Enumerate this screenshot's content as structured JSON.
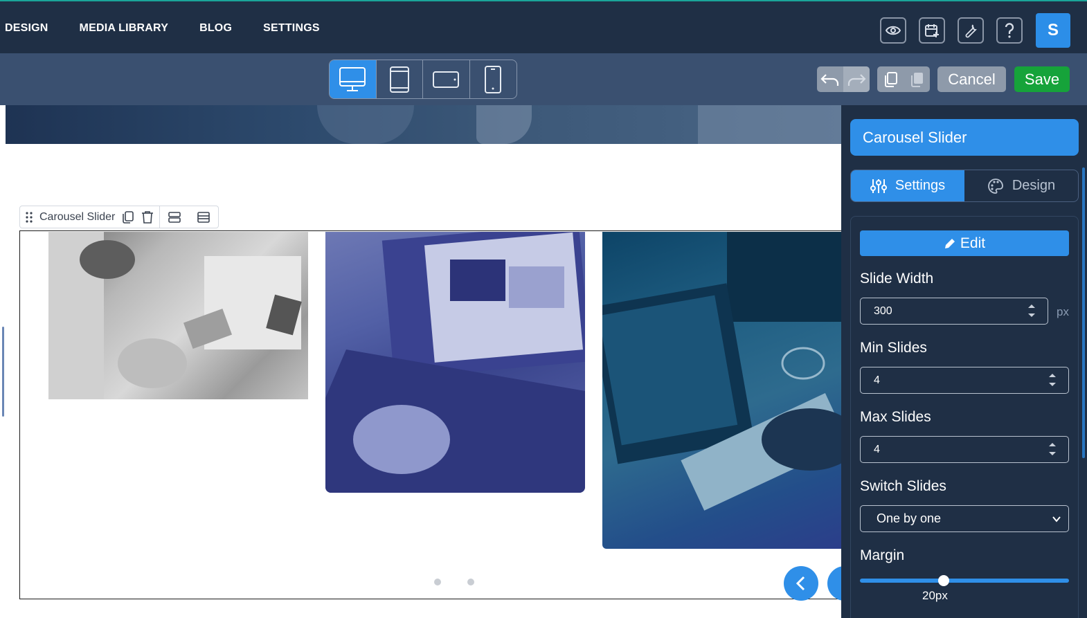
{
  "topnav": {
    "items": [
      "DESIGN",
      "MEDIA LIBRARY",
      "BLOG",
      "SETTINGS"
    ],
    "icons": [
      "eye-icon",
      "calendar-plus-icon",
      "wrench-icon",
      "question-icon"
    ],
    "avatar_letter": "S"
  },
  "toolbar": {
    "devices": [
      "desktop",
      "tablet",
      "tablet-landscape",
      "mobile"
    ],
    "active_device": "desktop",
    "cancel_label": "Cancel",
    "save_label": "Save"
  },
  "canvas": {
    "element_label": "Carousel Slider",
    "slides": [
      "office-people-photo",
      "laptop-design-photo",
      "tablet-code-photo"
    ],
    "dot_count": 2
  },
  "panel": {
    "title": "Carousel Slider",
    "tabs": [
      {
        "label": "Settings",
        "active": true
      },
      {
        "label": "Design",
        "active": false
      }
    ],
    "edit_label": "Edit",
    "slide_width": {
      "label": "Slide Width",
      "value": "300",
      "unit": "px"
    },
    "min_slides": {
      "label": "Min Slides",
      "value": "4"
    },
    "max_slides": {
      "label": "Max Slides",
      "value": "4"
    },
    "switch_slides": {
      "label": "Switch Slides",
      "value": "One by one"
    },
    "margin": {
      "label": "Margin",
      "value": "20px",
      "fraction": 0.4
    }
  },
  "colors": {
    "accent": "#2f8fe8",
    "save": "#16a33a",
    "nav_bg": "#1f2f45",
    "toolbar_bg": "#3a5070"
  }
}
